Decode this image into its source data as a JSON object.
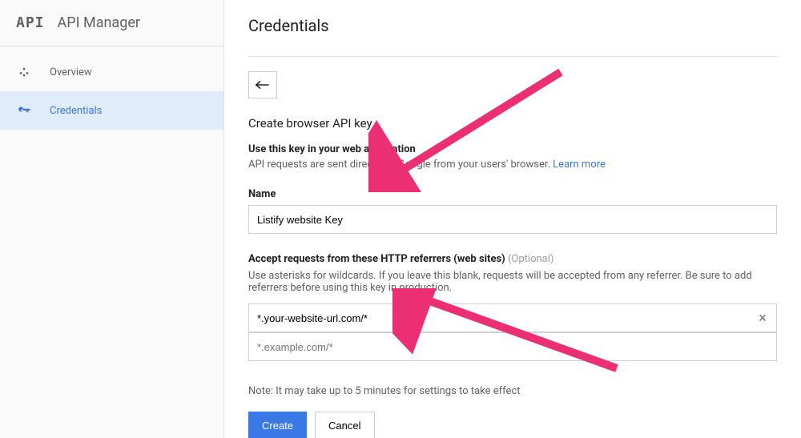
{
  "sidebar": {
    "logo": "API",
    "title": "API Manager",
    "items": [
      {
        "label": "Overview",
        "active": false
      },
      {
        "label": "Credentials",
        "active": true
      }
    ]
  },
  "page": {
    "title": "Credentials",
    "subtitle": "Create browser API key",
    "use_heading": "Use this key in your web application",
    "use_desc_prefix": "API requests are sent directly to Google from your users' browser. ",
    "learn_more": "Learn more",
    "name_label": "Name",
    "name_value": "Listify website Key",
    "referrers_label": "Accept requests from these HTTP referrers (web sites)",
    "referrers_optional": "(Optional)",
    "referrers_desc": "Use asterisks for wildcards. If you leave this blank, requests will be accepted from any referrer. Be sure to add referrers before using this key in production.",
    "referrer_value": "*.your-website-url.com/*",
    "referrer_placeholder": "*.example.com/*",
    "note": "Note: It may take up to 5 minutes for settings to take effect",
    "create_label": "Create",
    "cancel_label": "Cancel"
  }
}
